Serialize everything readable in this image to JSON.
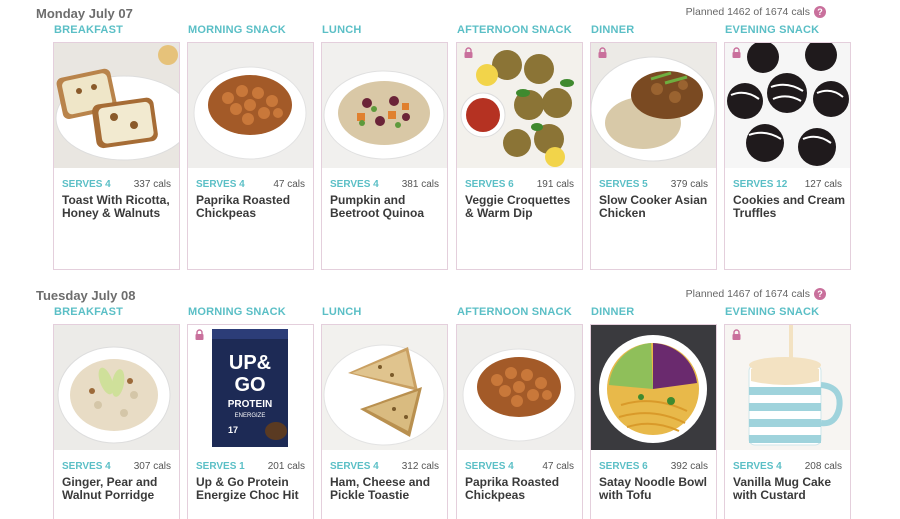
{
  "days": [
    {
      "title": "Monday July 07",
      "planned": "Planned 1462 of 1674 cals",
      "meals": [
        {
          "slot": "BREAKFAST",
          "serves": "SERVES 4",
          "cals": "337 cals",
          "name": "Toast With Ricotta, Honey & Walnuts",
          "locked": false
        },
        {
          "slot": "MORNING SNACK",
          "serves": "SERVES 4",
          "cals": "47 cals",
          "name": "Paprika Roasted Chickpeas",
          "locked": false
        },
        {
          "slot": "LUNCH",
          "serves": "SERVES 4",
          "cals": "381 cals",
          "name": "Pumpkin and Beetroot Quinoa",
          "locked": false
        },
        {
          "slot": "AFTERNOON SNACK",
          "serves": "SERVES 6",
          "cals": "191 cals",
          "name": "Veggie Croquettes & Warm Dip",
          "locked": true
        },
        {
          "slot": "DINNER",
          "serves": "SERVES 5",
          "cals": "379 cals",
          "name": "Slow Cooker Asian Chicken",
          "locked": true
        },
        {
          "slot": "EVENING SNACK",
          "serves": "SERVES 12",
          "cals": "127 cals",
          "name": "Cookies and Cream Truffles",
          "locked": true
        }
      ]
    },
    {
      "title": "Tuesday July 08",
      "planned": "Planned 1467 of 1674 cals",
      "meals": [
        {
          "slot": "BREAKFAST",
          "serves": "SERVES 4",
          "cals": "307 cals",
          "name": "Ginger, Pear and Walnut Porridge",
          "locked": false
        },
        {
          "slot": "MORNING SNACK",
          "serves": "SERVES 1",
          "cals": "201 cals",
          "name": "Up & Go Protein Energize Choc Hit",
          "locked": true
        },
        {
          "slot": "LUNCH",
          "serves": "SERVES 4",
          "cals": "312 cals",
          "name": "Ham, Cheese and Pickle Toastie",
          "locked": false
        },
        {
          "slot": "AFTERNOON SNACK",
          "serves": "SERVES 4",
          "cals": "47 cals",
          "name": "Paprika Roasted Chickpeas",
          "locked": false
        },
        {
          "slot": "DINNER",
          "serves": "SERVES 6",
          "cals": "392 cals",
          "name": "Satay Noodle Bowl with Tofu",
          "locked": false
        },
        {
          "slot": "EVENING SNACK",
          "serves": "SERVES 4",
          "cals": "208 cals",
          "name": "Vanilla Mug Cake with Custard",
          "locked": true
        }
      ]
    }
  ],
  "help_glyph": "?",
  "colors": {
    "accent": "#5bbfc6",
    "lock": "#c9709c",
    "card_border": "#e4cfdc"
  },
  "icons": {
    "lock": "lock-icon",
    "help": "help-circle-icon"
  },
  "product": {
    "brand_line1": "UP&",
    "brand_line2": "GO",
    "tagline": "PROTEIN",
    "sub": "ENERGIZE",
    "count": "17"
  }
}
